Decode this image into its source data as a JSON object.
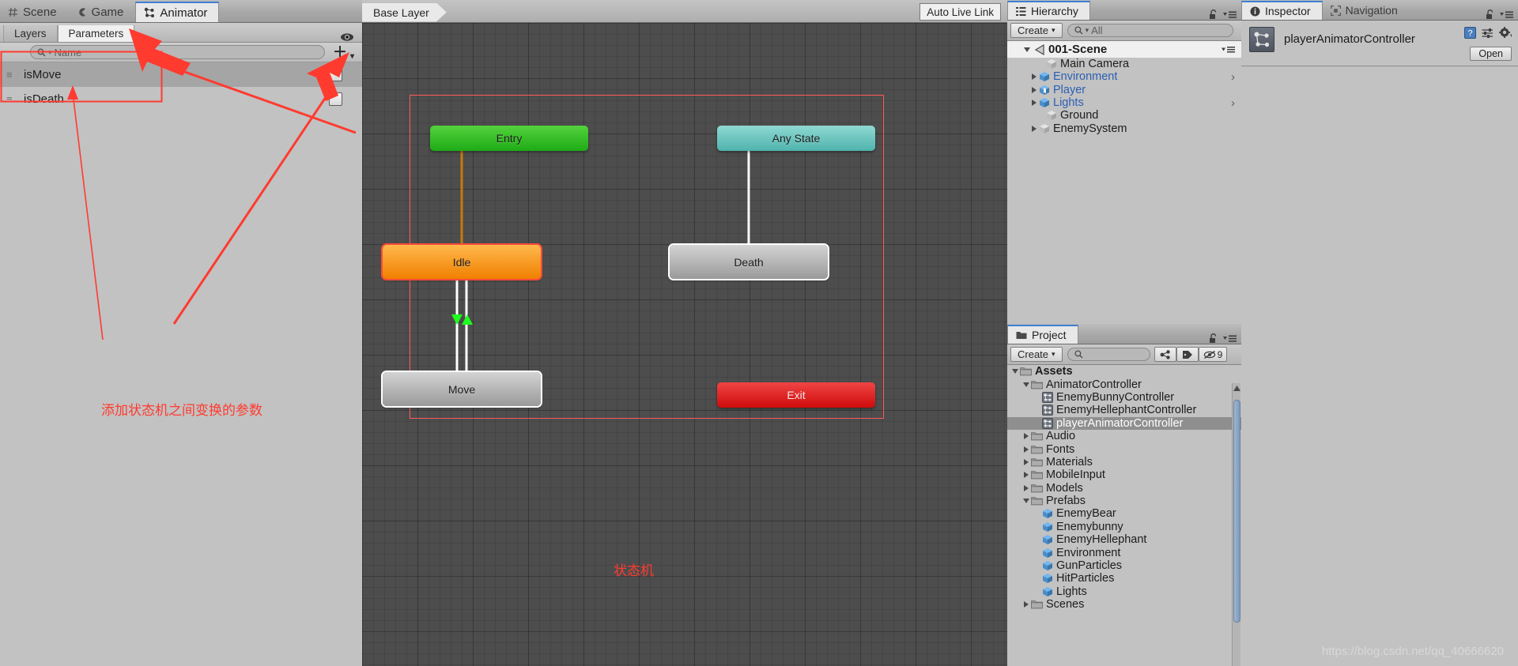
{
  "animator": {
    "tabs": [
      {
        "label": "Scene",
        "icon": "grid-icon",
        "active": false
      },
      {
        "label": "Game",
        "icon": "gamepad-icon",
        "active": false
      },
      {
        "label": "Animator",
        "icon": "animator-icon",
        "active": true
      }
    ],
    "subtabs": [
      {
        "label": "Layers",
        "active": false
      },
      {
        "label": "Parameters",
        "active": true
      }
    ],
    "eye_icon": "eye-icon",
    "search": {
      "placeholder": "Name",
      "value": "",
      "icon": "search-icon"
    },
    "add_button_label": "+",
    "parameters": [
      {
        "name": "isMove",
        "type": "bool",
        "value": false
      },
      {
        "name": "isDeath",
        "type": "bool",
        "value": false
      }
    ]
  },
  "graph": {
    "breadcrumb": "Base Layer",
    "auto_live_link": "Auto Live Link",
    "nodes": [
      {
        "id": "entry",
        "label": "Entry",
        "style": "entry"
      },
      {
        "id": "anystate",
        "label": "Any State",
        "style": "anystate"
      },
      {
        "id": "idle",
        "label": "Idle",
        "style": "idle"
      },
      {
        "id": "death",
        "label": "Death",
        "style": "gray"
      },
      {
        "id": "move",
        "label": "Move",
        "style": "gray"
      },
      {
        "id": "exit",
        "label": "Exit",
        "style": "exit"
      }
    ],
    "transitions": [
      {
        "from": "entry",
        "to": "idle",
        "color": "#c47b0a"
      },
      {
        "from": "anystate",
        "to": "death",
        "color": "#ffffff"
      },
      {
        "from": "idle",
        "to": "move",
        "color": "#ffffff",
        "bidirectional": true,
        "marker": "#1eff1e"
      }
    ],
    "annotations": [
      {
        "id": "ann-params",
        "text": "添加状态机之间变换的参数"
      },
      {
        "id": "ann-statemachine",
        "text": "状态机"
      }
    ]
  },
  "hierarchy": {
    "tab": "Hierarchy",
    "tab_icon": "hierarchy-icon",
    "create_label": "Create",
    "search": {
      "placeholder": "All",
      "value": "",
      "icon": "search-icon"
    },
    "scene": {
      "name": "001-Scene",
      "expanded": true
    },
    "items": [
      {
        "label": "Main Camera",
        "indent": 2,
        "expandable": false,
        "icon": "gameobject-icon",
        "blue": false,
        "overflow": false
      },
      {
        "label": "Environment",
        "indent": 1,
        "expandable": true,
        "icon": "prefab-icon",
        "blue": true,
        "overflow": true
      },
      {
        "label": "Player",
        "indent": 1,
        "expandable": true,
        "icon": "prefab-icon",
        "blue": true,
        "overflow": false
      },
      {
        "label": "Lights",
        "indent": 1,
        "expandable": true,
        "icon": "prefab-icon",
        "blue": true,
        "overflow": true
      },
      {
        "label": "Ground",
        "indent": 2,
        "expandable": false,
        "icon": "gameobject-icon",
        "blue": false,
        "overflow": false
      },
      {
        "label": "EnemySystem",
        "indent": 1,
        "expandable": true,
        "icon": "gameobject-icon",
        "blue": false,
        "overflow": false
      }
    ]
  },
  "project": {
    "tab": "Project",
    "tab_icon": "folder-icon",
    "create_label": "Create",
    "search": {
      "placeholder": "",
      "value": "",
      "icon": "search-icon"
    },
    "toolbar_icons": [
      "favorites-icon",
      "label-icon",
      "hidden-icon"
    ],
    "hidden_count": "9",
    "items": [
      {
        "label": "Assets",
        "indent": 0,
        "state": "expanded",
        "icon": "folder-icon",
        "selected": false,
        "bold": true
      },
      {
        "label": "AnimatorController",
        "indent": 1,
        "state": "expanded",
        "icon": "folder-icon",
        "selected": false,
        "bold": false
      },
      {
        "label": "EnemyBunnyController",
        "indent": 2,
        "state": "leaf",
        "icon": "animator-asset-icon",
        "selected": false,
        "bold": false
      },
      {
        "label": "EnemyHellephantController",
        "indent": 2,
        "state": "leaf",
        "icon": "animator-asset-icon",
        "selected": false,
        "bold": false
      },
      {
        "label": "playerAnimatorController",
        "indent": 2,
        "state": "leaf",
        "icon": "animator-asset-icon",
        "selected": true,
        "bold": false
      },
      {
        "label": "Audio",
        "indent": 1,
        "state": "collapsed",
        "icon": "folder-icon",
        "selected": false,
        "bold": false
      },
      {
        "label": "Fonts",
        "indent": 1,
        "state": "collapsed",
        "icon": "folder-icon",
        "selected": false,
        "bold": false
      },
      {
        "label": "Materials",
        "indent": 1,
        "state": "collapsed",
        "icon": "folder-icon",
        "selected": false,
        "bold": false
      },
      {
        "label": "MobileInput",
        "indent": 1,
        "state": "collapsed",
        "icon": "folder-icon",
        "selected": false,
        "bold": false
      },
      {
        "label": "Models",
        "indent": 1,
        "state": "collapsed",
        "icon": "folder-icon",
        "selected": false,
        "bold": false
      },
      {
        "label": "Prefabs",
        "indent": 1,
        "state": "expanded",
        "icon": "folder-icon",
        "selected": false,
        "bold": false
      },
      {
        "label": "EnemyBear",
        "indent": 2,
        "state": "leaf",
        "icon": "prefab-icon",
        "selected": false,
        "bold": false
      },
      {
        "label": "Enemybunny",
        "indent": 2,
        "state": "leaf",
        "icon": "prefab-icon",
        "selected": false,
        "bold": false
      },
      {
        "label": "EnemyHellephant",
        "indent": 2,
        "state": "leaf",
        "icon": "prefab-icon",
        "selected": false,
        "bold": false
      },
      {
        "label": "Environment",
        "indent": 2,
        "state": "leaf",
        "icon": "prefab-icon",
        "selected": false,
        "bold": false
      },
      {
        "label": "GunParticles",
        "indent": 2,
        "state": "leaf",
        "icon": "prefab-icon",
        "selected": false,
        "bold": false
      },
      {
        "label": "HitParticles",
        "indent": 2,
        "state": "leaf",
        "icon": "prefab-icon",
        "selected": false,
        "bold": false
      },
      {
        "label": "Lights",
        "indent": 2,
        "state": "leaf",
        "icon": "prefab-icon",
        "selected": false,
        "bold": false
      },
      {
        "label": "Scenes",
        "indent": 1,
        "state": "collapsed",
        "icon": "folder-icon",
        "selected": false,
        "bold": false
      }
    ]
  },
  "inspector": {
    "tabs": [
      {
        "label": "Inspector",
        "icon": "info-icon",
        "active": true
      },
      {
        "label": "Navigation",
        "icon": "navigation-icon",
        "active": false
      }
    ],
    "object_name": "playerAnimatorController",
    "object_icon": "animator-asset-icon",
    "open_label": "Open",
    "header_icons": [
      "help-icon",
      "preset-icon",
      "gear-icon"
    ]
  },
  "watermark": "https://blog.csdn.net/qq_40666620"
}
